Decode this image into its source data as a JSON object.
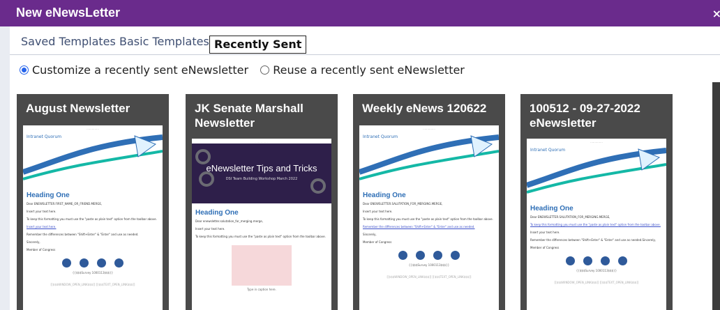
{
  "dialog": {
    "title": "New eNewsLetter",
    "close_label": "×"
  },
  "tabs": [
    "Saved Templates",
    "Basic Templates",
    "Recently Sent"
  ],
  "options": [
    "Customize a recently sent eNewsletter",
    "Reuse a recently sent eNewsletter"
  ],
  "cards": [
    {
      "title": "August Newsletter",
      "tag": "Intranet Quorum",
      "heading": "Heading One",
      "lines": [
        "Dear ENEWSLETTER.FIRST_NAME_OR_FRIEND.MERGE,",
        "Insert your text here.",
        "To keep this formatting you must use the \"paste as plain text\" option from the toolbar above.",
        "Insert your text here.",
        "Remember the differences between \"Shift+Enter\" & \"Enter\" and use as needed.",
        "Sincerely,",
        "Member of Congress"
      ],
      "footer": "{{$$$Survey 1000113$$$}}",
      "footer2": "[[$$$WINDOW_OPEN_LINK$$$]]    [[$$$TEXT_OPEN_LINK$$$]]"
    },
    {
      "title": "JK Senate Marshall Newsletter",
      "tips_title": "eNewsletter Tips and Tricks",
      "tips_sub": "DSI Team Building Workshop March 2022",
      "heading": "Heading One",
      "lines": [
        "Dear enewsletter.salutation_for_merging.merge,",
        "Insert your text here.",
        "To keep this formatting you must use the \"paste as plain text\" option from the toolbar above."
      ],
      "caption": "Type in caption here."
    },
    {
      "title": "Weekly eNews 120622",
      "tag": "Intranet Quorum",
      "heading": "Heading One",
      "lines": [
        "Dear ENEWSLETTER.SALUTATION_FOR_MERGING.MERGE,",
        "Insert your text here.",
        "To keep this formatting you must use the \"paste as plain text\" option from the toolbar above.",
        "Remember the differences between \"Shift+Enter\" & \"Enter\" and use as needed.",
        "Sincerely,",
        "Member of Congress"
      ],
      "footer": "{{$$$Survey 1000113$$$}}",
      "footer2": "[[$$$WINDOW_OPEN_LINK$$$]]    [[$$$TEXT_OPEN_LINK$$$]]"
    },
    {
      "title": "100512 - 09-27-2022 eNewsletter",
      "tag": "Intranet Quorum",
      "heading": "Heading One",
      "lines": [
        "Dear ENEWSLETTER.SALUTATION_FOR_MERGING.MERGE,",
        "To keep this formatting you must use the \"paste as plain text\" option from the toolbar above.",
        "Insert your text here.",
        "Remember the differences between \"Shift+Enter\" & \"Enter\" and use as needed.Sincerely,",
        "Member of Congress"
      ],
      "footer": "{{$$$Survey 1000113$$$}}",
      "footer2": "[[$$$WINDOW_OPEN_LINK$$$]]    [[$$$TEXT_OPEN_LINK$$$]]"
    }
  ],
  "colors": {
    "titlebar": "#6a2b8c",
    "accent": "#2563eb",
    "card": "#4a4a4a",
    "heading": "#2f6fb6"
  }
}
